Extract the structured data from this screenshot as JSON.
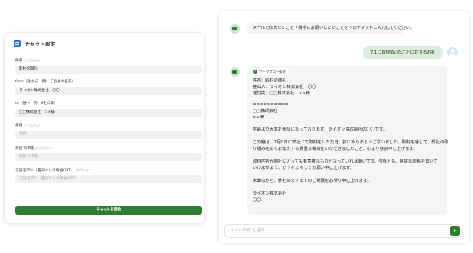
{
  "settings": {
    "title": "チャット設定",
    "fields": [
      {
        "label": "件名",
        "optional": "オプション",
        "value": "取材の御礼",
        "placeholder": ""
      },
      {
        "label": "from（誰から　例：ご自身の名前）",
        "optional": "",
        "value": "ライオン株式会社　〇〇",
        "placeholder": ""
      },
      {
        "label": "to（誰へ　例：B社C様）",
        "optional": "",
        "value": "□□株式会社　××様",
        "placeholder": ""
      },
      {
        "label": "条件",
        "optional": "オプション",
        "value": "",
        "placeholder": "条件"
      },
      {
        "label": "英語で作成",
        "optional": "オプション",
        "value": "",
        "placeholder": "英語で作成"
      },
      {
        "label": "言語モデル（選択なしの場合GPT）",
        "optional": "オプション",
        "value": "",
        "placeholder": "言語モデル（選択なしの場合GPT）"
      }
    ],
    "start_button": "チャットを開始"
  },
  "chat": {
    "bot_intro": "メールで伝えたいこと・相手にお願いしたいことを下のチャットに入力してください。",
    "user_message": "7/1に取材頂いたことに対するお礼",
    "workflow_tag": "ワークフロー処理",
    "mail_lines": [
      "件名：取材の御礼",
      "差出人：ライオン株式会社　〇〇",
      "送付先：□□株式会社　××様",
      "==========",
      "□□株式会社",
      "××様",
      "平素より大変お世話になっております。ライオン株式会社の〇〇です。",
      "この度は、7月1日に弊社にて取材をいただき、誠にありがとうございました。取材を通じて、弊社の取",
      "り組みを広くお伝えする貴重な機会をいただきましたこと、心より感謝申し上げます。",
      "取材内容が御社にとっても有意義なものとなっていれば幸いです。今後とも、良好な関係を築いて",
      "いけますよう、どうぞよろしくお願い申し上げます。",
      "末筆ながら、貴社のますますのご発展をお祈り申し上げます。",
      "ライオン株式会社",
      "〇〇"
    ],
    "input_placeholder": "メール作成 と話す"
  },
  "icons": {
    "settings": "chat-settings-icon",
    "bot": "bot-avatar-icon",
    "user": "user-avatar-icon",
    "check": "check-icon",
    "send": "send-icon",
    "chevron": "chevron-down-icon"
  },
  "colors": {
    "accent": "#2e7d32",
    "user_bubble": "#dbeedd",
    "bot_bubble": "#f5f5f5",
    "input_bg": "#f0f1f3"
  }
}
